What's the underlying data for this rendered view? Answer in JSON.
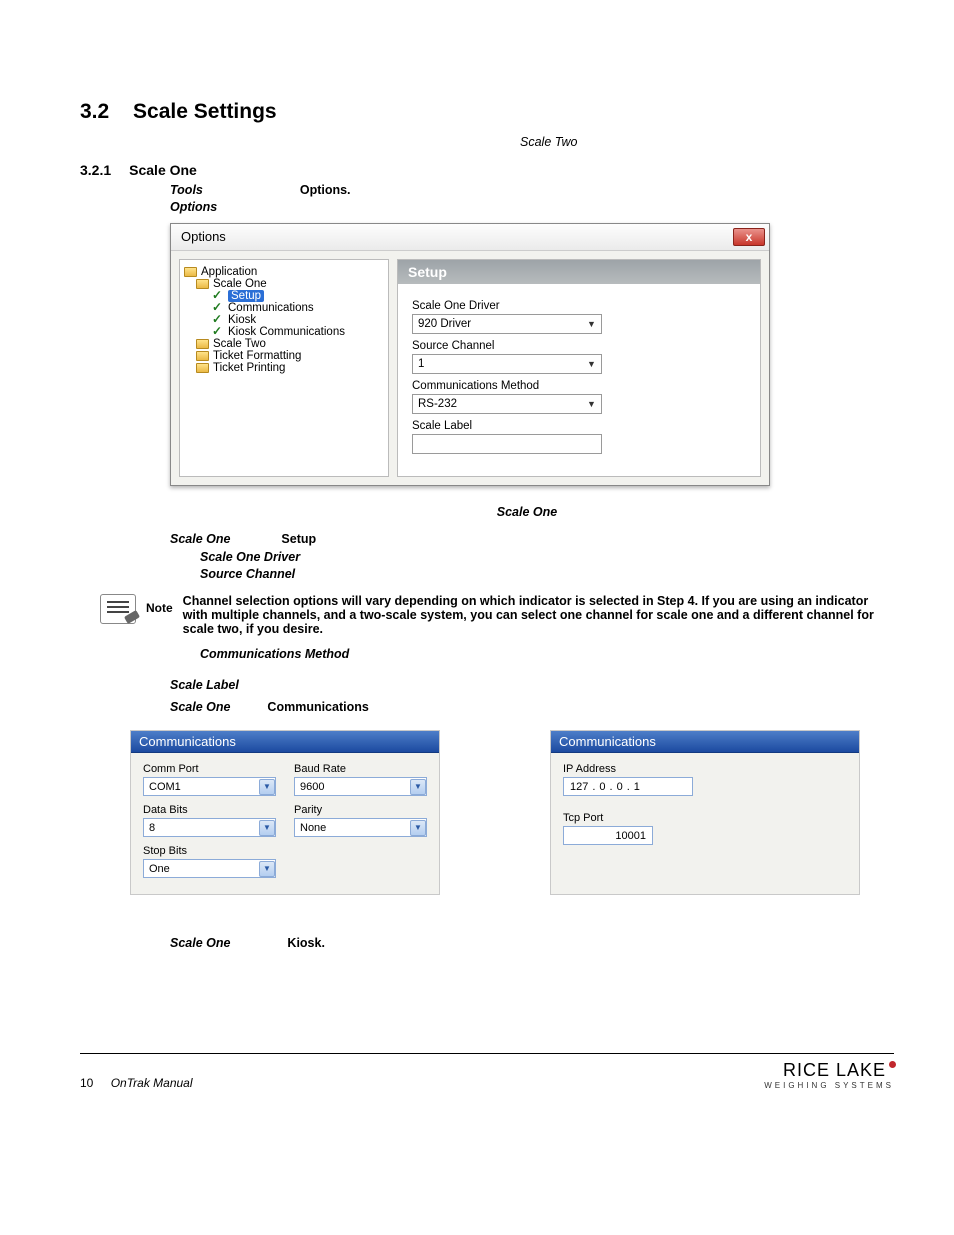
{
  "section": {
    "number": "3.2",
    "title": "Scale Settings"
  },
  "scale_two_hint": "Scale Two",
  "subsection": {
    "number": "3.2.1",
    "title": "Scale One"
  },
  "intro": {
    "tools": "Tools",
    "options": "Options.",
    "options_label": "Options"
  },
  "dialog": {
    "title": "Options",
    "close_x": "x",
    "tree": {
      "application": "Application",
      "scale_one": "Scale One",
      "setup": "Setup",
      "communications": "Communications",
      "kiosk": "Kiosk",
      "kiosk_comm": "Kiosk Communications",
      "scale_two": "Scale Two",
      "ticket_formatting": "Ticket Formatting",
      "ticket_printing": "Ticket Printing"
    },
    "setup": {
      "header": "Setup",
      "driver_label": "Scale One Driver",
      "driver_value": "920 Driver",
      "source_label": "Source Channel",
      "source_value": "1",
      "comm_label": "Communications Method",
      "comm_value": "RS-232",
      "scale_label_label": "Scale Label"
    }
  },
  "mid": {
    "scale_one_center": "Scale One",
    "step_scale_one": "Scale One",
    "step_setup": "Setup",
    "driver": "Scale One Driver",
    "source": "Source Channel",
    "comm_method": "Communications Method",
    "scale_label": "Scale Label",
    "step9_scale_one": "Scale One",
    "step9_comm": "Communications"
  },
  "note": {
    "label": "Note",
    "text": "Channel selection options will vary depending on which indicator is selected in Step 4. If you are using an indicator with multiple channels, and a two-scale system, you can select one channel for scale one and a different channel for scale two, if you desire."
  },
  "panel_a": {
    "header": "Communications",
    "comm_port_label": "Comm Port",
    "comm_port_value": "COM1",
    "baud_label": "Baud Rate",
    "baud_value": "9600",
    "data_bits_label": "Data Bits",
    "data_bits_value": "8",
    "parity_label": "Parity",
    "parity_value": "None",
    "stop_bits_label": "Stop Bits",
    "stop_bits_value": "One"
  },
  "panel_b": {
    "header": "Communications",
    "ip_label": "IP Address",
    "ip_parts": [
      "127",
      "0",
      "0",
      "1"
    ],
    "tcp_label": "Tcp Port",
    "tcp_value": "10001"
  },
  "tail": {
    "scale_one": "Scale One",
    "kiosk": "Kiosk."
  },
  "footer": {
    "page": "10",
    "manual": "OnTrak Manual",
    "brand_main": "RICE LAKE",
    "brand_sub": "WEIGHING SYSTEMS"
  }
}
